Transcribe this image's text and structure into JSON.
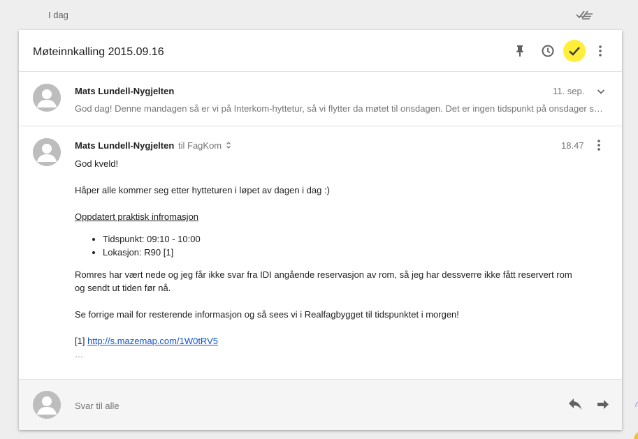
{
  "day_header": {
    "label": "I dag",
    "sweep_icon": "sweep-icon"
  },
  "thread": {
    "subject": "Møteinnkalling 2015.09.16",
    "actions": [
      {
        "icon": "pin-icon"
      },
      {
        "icon": "clock-icon"
      },
      {
        "icon": "checkmark-icon",
        "highlight": "#ffef3b"
      },
      {
        "icon": "more-vert-icon"
      }
    ]
  },
  "messages": [
    {
      "sender": "Mats Lundell-Nygjelten",
      "date": "11. sep.",
      "snippet": "God dag! Denne mandagen så er vi på Interkom-hyttetur, så vi flytter da møtet til onsdagen. Det er ingen tidspunkt på onsdager som passer for alle. Beklager!"
    },
    {
      "sender": "Mats Lundell-Nygjelten",
      "recipient": "til FagKom",
      "date": "18.47",
      "body": {
        "greeting": "God kveld!",
        "line1": "Håper alle kommer seg etter hytteturen i løpet av dagen i dag :)",
        "heading": "Oppdatert praktisk infromasjon",
        "bullets": [
          "Tidspunkt: 09:10 - 10:00",
          "Lokasjon: R90 [1]"
        ],
        "para1": "Romres har vært nede og jeg får ikke svar fra IDI angående reservasjon av rom, så jeg har dessverre ikke fått reservert rom og sendt ut tiden før nå.",
        "para2": "Se forrige mail for resterende informasjon og så sees vi i Realfagbygget til tidspunktet i morgen!",
        "ref_prefix": "[1]",
        "link": "http://s.mazemap.com/1W0tRV5",
        "trimmed": "…"
      }
    }
  ],
  "reply": {
    "placeholder": "Svar til alle"
  },
  "colors": {
    "background": "#eeeeee",
    "card": "#ffffff",
    "done_highlight": "#ffef3b",
    "link": "#1155cc",
    "avatar": "#bdbdbd"
  }
}
